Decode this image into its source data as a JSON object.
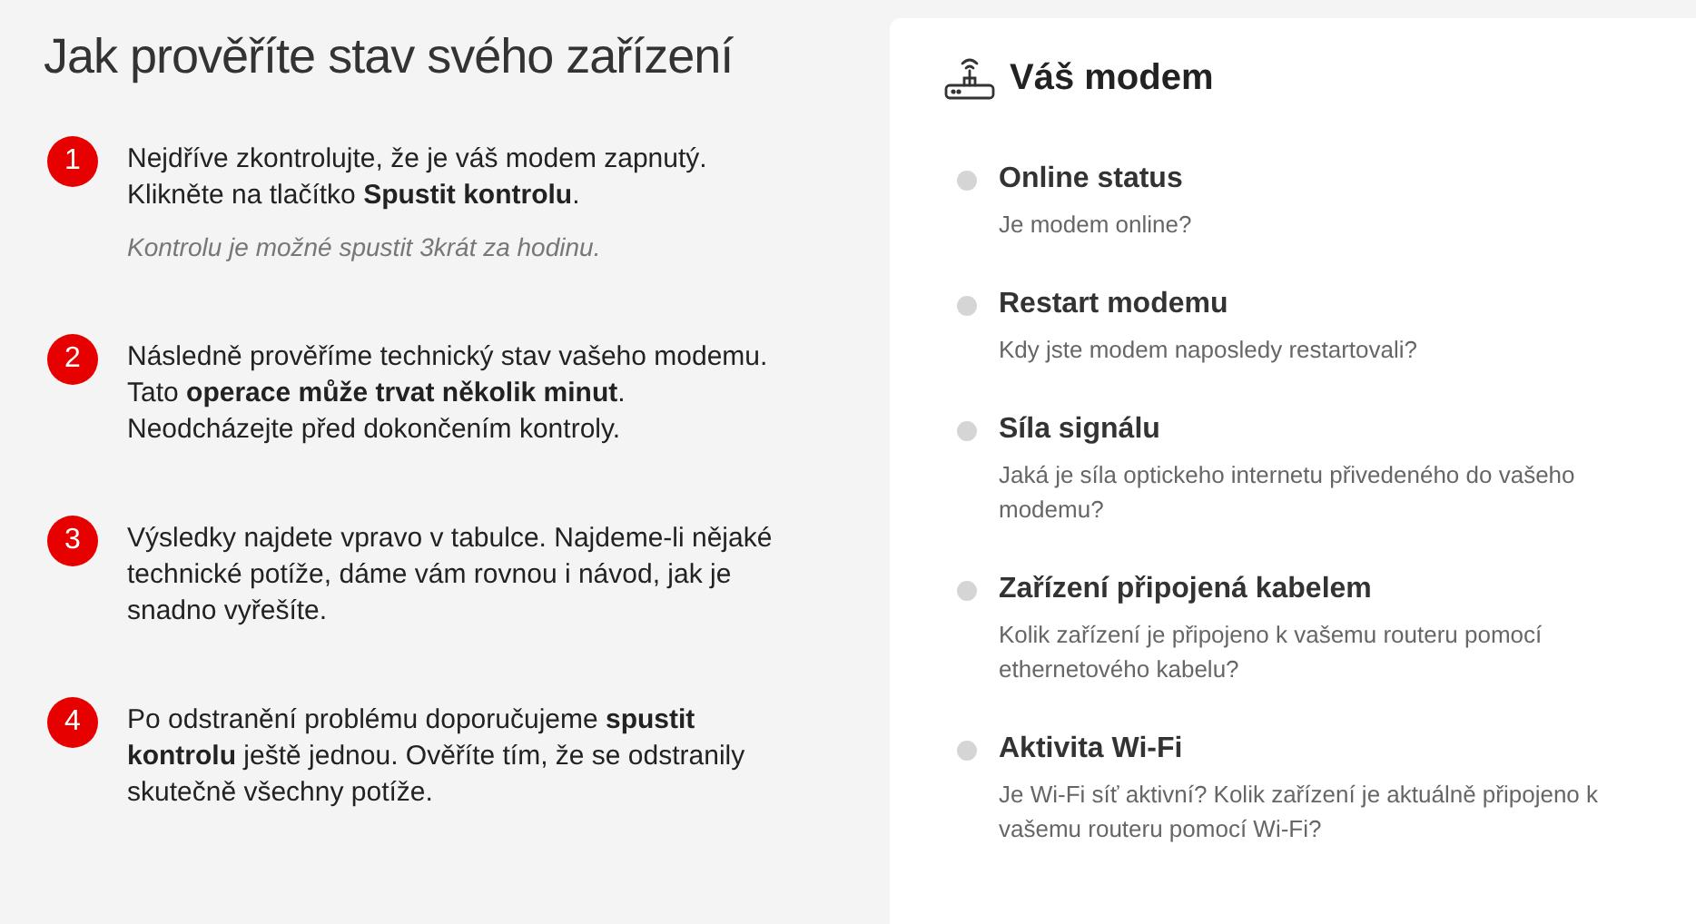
{
  "heading": "Jak prověříte stav svého zařízení",
  "steps": [
    {
      "number": "1",
      "text": "Nejdříve zkontrolujte, že je váš modem zapnutý. Klikněte na tlačítko **Spustit kontrolu**.",
      "note": "Kontrolu je možné spustit 3krát za hodinu."
    },
    {
      "number": "2",
      "text": "Následně prověříme technický stav vašeho modemu. Tato **operace může trvat několik minut**. Neodcházejte před dokončením kontroly."
    },
    {
      "number": "3",
      "text": "Výsledky najdete vpravo v tabulce. Najdeme-li nějaké technické potíže, dáme vám rovnou i návod, jak je snadno vyřešíte."
    },
    {
      "number": "4",
      "text": "Po odstranění problému doporučujeme **spustit kontrolu** ještě jednou. Ověříte tím, že se odstranily skutečně všechny potíže."
    }
  ],
  "modem_card": {
    "title": "Váš modem",
    "checks": [
      {
        "title": "Online status",
        "description": "Je modem online?",
        "done": false
      },
      {
        "title": "Restart modemu",
        "description": "Kdy jste modem naposledy restartovali?",
        "done": false
      },
      {
        "title": "Síla signálu",
        "description": "Jaká je síla optickeho internetu přivedeného do vašeho modemu?",
        "done": false
      },
      {
        "title": "Zařízení připojená kabelem",
        "description": "Kolik zařízení je připojeno k vašemu routeru pomocí ethernetového kabelu?",
        "done": false
      },
      {
        "title": "Aktivita Wi-Fi",
        "description": "Je Wi-Fi síť aktivní? Kolik zařízení je aktuálně připojeno k vašemu routeru pomocí Wi-Fi?",
        "done": false
      }
    ]
  }
}
